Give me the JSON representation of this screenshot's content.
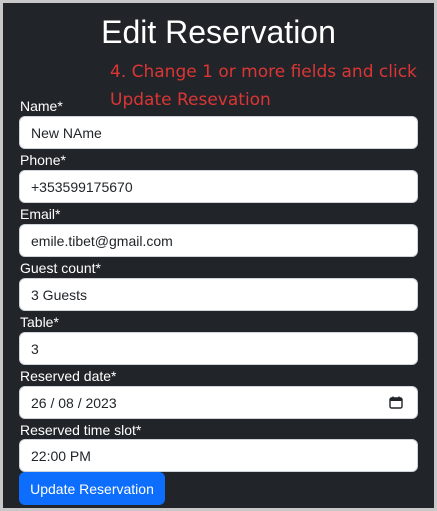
{
  "page": {
    "title": "Edit Reservation",
    "annotation_line1": "4. Change 1 or more fields and click",
    "annotation_line2": "Update Resevation"
  },
  "form": {
    "name_label": "Name*",
    "name_value": "New NAme",
    "phone_label": "Phone*",
    "phone_value": "+353599175670",
    "email_label": "Email*",
    "email_value": "emile.tibet@gmail.com",
    "guest_label": "Guest count*",
    "guest_value": "3 Guests",
    "table_label": "Table*",
    "table_value": "3",
    "date_label": "Reserved date*",
    "date_value": "26 / 08 / 2023",
    "time_label": "Reserved time slot*",
    "time_value": "22:00 PM",
    "submit_label": "Update Reservation"
  },
  "colors": {
    "background": "#212529",
    "annotation": "#dc3535",
    "button": "#0d6efd"
  },
  "icons": {
    "date_picker": "calendar-icon"
  }
}
